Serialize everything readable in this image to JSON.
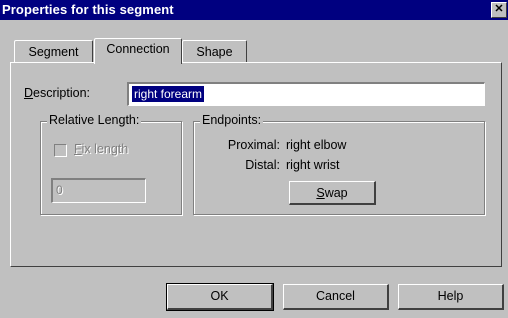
{
  "window": {
    "title": "Properties for this segment",
    "close_glyph": "✕"
  },
  "tabs": [
    {
      "label": "Segment",
      "active": false
    },
    {
      "label": "Connection",
      "active": true
    },
    {
      "label": "Shape",
      "active": false
    }
  ],
  "description": {
    "label_first": "D",
    "label_rest": "escription:",
    "value": "right forearm"
  },
  "relative_length": {
    "title": "Relative Length:",
    "fix_length_first": "F",
    "fix_length_rest": "ix length",
    "fix_length_checked": false,
    "length_value": "0"
  },
  "endpoints": {
    "title": "Endpoints:",
    "proximal_label": "Proximal:",
    "proximal_value": "right elbow",
    "distal_label": "Distal:",
    "distal_value": "right wrist",
    "swap_first": "S",
    "swap_rest": "wap"
  },
  "buttons": {
    "ok": "OK",
    "cancel": "Cancel",
    "help": "Help"
  }
}
